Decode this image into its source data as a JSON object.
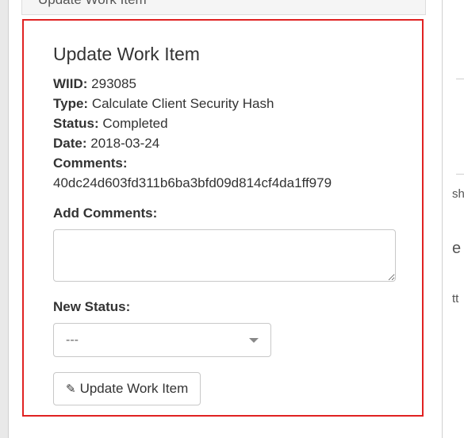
{
  "header": {
    "title": "Update Work Item"
  },
  "form": {
    "title": "Update Work Item",
    "wiid_label": "WIID:",
    "wiid_value": "293085",
    "type_label": "Type:",
    "type_value": "Calculate Client Security Hash",
    "status_label": "Status:",
    "status_value": "Completed",
    "date_label": "Date:",
    "date_value": "2018-03-24",
    "comments_label": "Comments:",
    "comments_value": "40dc24d603fd311b6ba3bfd09d814cf4da1ff979",
    "add_comments_label": "Add Comments:",
    "add_comments_value": "",
    "new_status_label": "New Status:",
    "new_status_value": "---",
    "submit_label": "Update Work Item",
    "submit_icon": "pencil-icon"
  },
  "background": {
    "frag1": "sh",
    "frag2": "e",
    "frag3": "tt"
  },
  "colors": {
    "highlight": "#e02222",
    "border": "#c8c8c8"
  }
}
